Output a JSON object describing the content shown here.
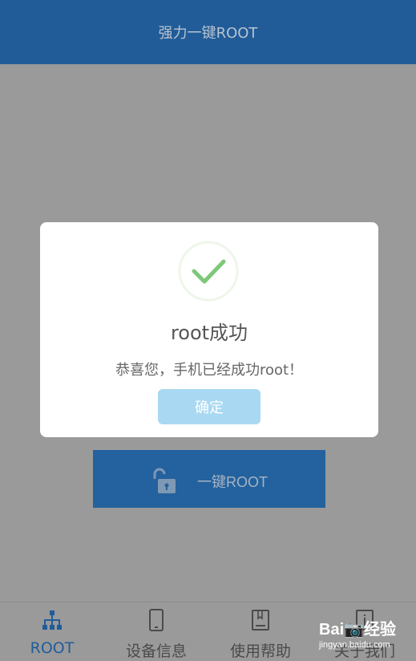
{
  "app": {
    "title": "强力一键ROOT"
  },
  "main": {
    "root_button_label": "一键ROOT"
  },
  "dialog": {
    "title": "root成功",
    "message": "恭喜您，手机已经成功root！",
    "confirm_label": "确定"
  },
  "nav": {
    "items": [
      {
        "label": "ROOT",
        "icon": "network-tree-icon",
        "active": true
      },
      {
        "label": "设备信息",
        "icon": "phone-icon",
        "active": false
      },
      {
        "label": "使用帮助",
        "icon": "book-icon",
        "active": false
      },
      {
        "label": "关于我们",
        "icon": "info-icon",
        "active": false
      }
    ]
  },
  "watermark": {
    "logo": "Bai📷经验",
    "url": "jingyan.baidu.com"
  },
  "colors": {
    "app_bar": "#215c99",
    "root_button": "#23629e",
    "active_tab": "#215c99",
    "success_green": "#7ec87a",
    "confirm_button": "#a9d9f2",
    "overlay_gray": "#9a9a9a"
  }
}
